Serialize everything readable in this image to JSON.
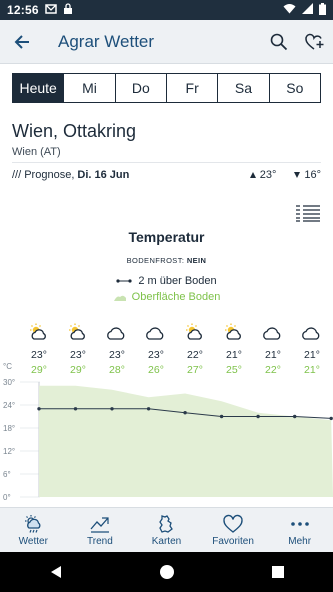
{
  "status_bar": {
    "time": "12:56"
  },
  "app_bar": {
    "title": "Agrar Wetter"
  },
  "day_tabs": [
    {
      "label": "Heute",
      "active": true
    },
    {
      "label": "Mi",
      "active": false
    },
    {
      "label": "Do",
      "active": false
    },
    {
      "label": "Fr",
      "active": false
    },
    {
      "label": "Sa",
      "active": false
    },
    {
      "label": "So",
      "active": false
    }
  ],
  "location": {
    "name": "Wien, Ottakring",
    "region": "Wien (AT)"
  },
  "forecast": {
    "prefix": "/// Prognose,",
    "date": "Di. 16 Jun",
    "max": "23°",
    "min": "16°"
  },
  "chart_header": {
    "title": "Temperatur",
    "frost_label": "BODENFROST:",
    "frost_value": "NEIN",
    "legend_air": "2 m über Boden",
    "legend_soil": "Oberfläche Boden"
  },
  "hours": [
    {
      "icon": "partly-sunny-rain-icon",
      "air": "23°",
      "soil": "29°"
    },
    {
      "icon": "partly-sunny-rain-icon",
      "air": "23°",
      "soil": "29°"
    },
    {
      "icon": "cloud-icon",
      "air": "23°",
      "soil": "28°"
    },
    {
      "icon": "cloud-icon",
      "air": "23°",
      "soil": "26°"
    },
    {
      "icon": "partly-sunny-rain-icon",
      "air": "22°",
      "soil": "27°"
    },
    {
      "icon": "partly-sunny-rain-icon",
      "air": "21°",
      "soil": "25°"
    },
    {
      "icon": "cloud-icon",
      "air": "21°",
      "soil": "22°"
    },
    {
      "icon": "cloud-icon",
      "air": "21°",
      "soil": "21°"
    }
  ],
  "chart_data": {
    "type": "area",
    "unit_label": "°C",
    "y_ticks": [
      "30°",
      "24°",
      "18°",
      "12°",
      "6°",
      "0°"
    ],
    "ylim": [
      0,
      30
    ],
    "series": [
      {
        "name": "2 m über Boden",
        "values": [
          23,
          23,
          23,
          23,
          22,
          21,
          21,
          21,
          20.5
        ],
        "color": "#2b3a4a"
      },
      {
        "name": "Oberfläche Boden",
        "values": [
          29,
          29,
          28,
          26,
          27,
          25,
          22,
          21,
          20
        ],
        "color": "#e3efd6"
      }
    ]
  },
  "bottom_nav": [
    {
      "label": "Wetter",
      "icon": "weather-icon"
    },
    {
      "label": "Trend",
      "icon": "trend-icon"
    },
    {
      "label": "Karten",
      "icon": "map-icon"
    },
    {
      "label": "Favoriten",
      "icon": "heart-icon"
    },
    {
      "label": "Mehr",
      "icon": "more-icon"
    }
  ],
  "colors": {
    "primary": "#1d4f7a",
    "dark": "#1d2b3a",
    "green": "#7ec24a",
    "area": "#e3efd6"
  }
}
